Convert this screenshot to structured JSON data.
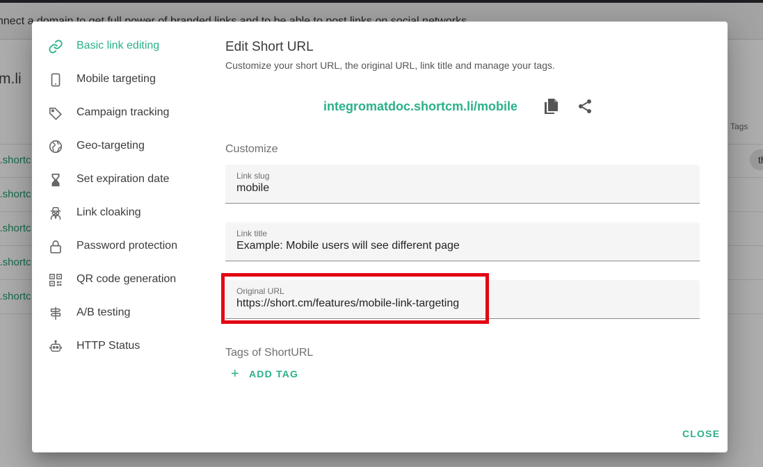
{
  "background": {
    "banner_text": "nnect a domain to get full power of branded links and to be able to post links on social networks",
    "domain_title": "m.li",
    "tags_header": "Tags",
    "tag_chip": "th",
    "rows": [
      "c.shortc",
      "c.shortc",
      "c.shortc",
      "c.shortc",
      "c.shortc"
    ]
  },
  "sidebar": {
    "items": [
      {
        "label": "Basic link editing",
        "icon": "link-icon",
        "active": true
      },
      {
        "label": "Mobile targeting",
        "icon": "mobile-icon"
      },
      {
        "label": "Campaign tracking",
        "icon": "tag-icon"
      },
      {
        "label": "Geo-targeting",
        "icon": "globe-icon"
      },
      {
        "label": "Set expiration date",
        "icon": "hourglass-icon"
      },
      {
        "label": "Link cloaking",
        "icon": "spy-icon"
      },
      {
        "label": "Password protection",
        "icon": "lock-icon"
      },
      {
        "label": "QR code generation",
        "icon": "qr-code-icon"
      },
      {
        "label": "A/B testing",
        "icon": "signpost-icon"
      },
      {
        "label": "HTTP Status",
        "icon": "robot-icon"
      }
    ]
  },
  "main": {
    "title": "Edit Short URL",
    "subtitle": "Customize your short URL, the original URL, link title and manage your tags.",
    "short_url": "integromatdoc.shortcm.li/mobile",
    "customize_label": "Customize",
    "fields": {
      "slug": {
        "label": "Link slug",
        "value": "mobile"
      },
      "title": {
        "label": "Link title",
        "value": "Example: Mobile users will see different page"
      },
      "original_url": {
        "label": "Original URL",
        "value": "https://short.cm/features/mobile-link-targeting"
      }
    },
    "tags_label": "Tags of ShortURL",
    "add_tag_label": "ADD TAG",
    "add_tag_icon": "+"
  },
  "footer": {
    "close_label": "CLOSE"
  },
  "colors": {
    "accent": "#2bb08a",
    "highlight": "#e20613"
  }
}
